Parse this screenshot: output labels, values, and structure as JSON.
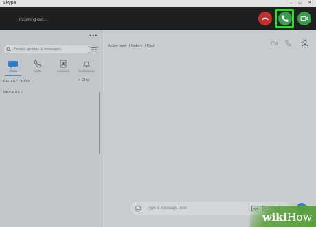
{
  "window": {
    "title": "Skype"
  },
  "call": {
    "status_text": "Incoming call..."
  },
  "sidebar": {
    "search_placeholder": "People, groups & messages",
    "tabs": [
      {
        "label": "Chats",
        "icon": "chat-bubble-icon",
        "active": true
      },
      {
        "label": "Calls",
        "icon": "phone-icon",
        "active": false
      },
      {
        "label": "Contacts",
        "icon": "contacts-icon",
        "active": false
      },
      {
        "label": "Notifications",
        "icon": "bell-icon",
        "active": false
      }
    ],
    "recent_chats_label": "RECENT CHATS ⌄",
    "new_chat_label": "+ Chat",
    "favorites_label": "FAVORITES"
  },
  "main": {
    "view_modes": [
      "Active view",
      "Gallery",
      "Find"
    ],
    "message_placeholder": "Type a message here"
  },
  "colors": {
    "decline": "#c0322e",
    "accept": "#3d9b4e",
    "highlight": "#29e21d",
    "accent": "#3b7fc4"
  },
  "watermark": {
    "brand_a": "wiki",
    "brand_b": "How"
  }
}
